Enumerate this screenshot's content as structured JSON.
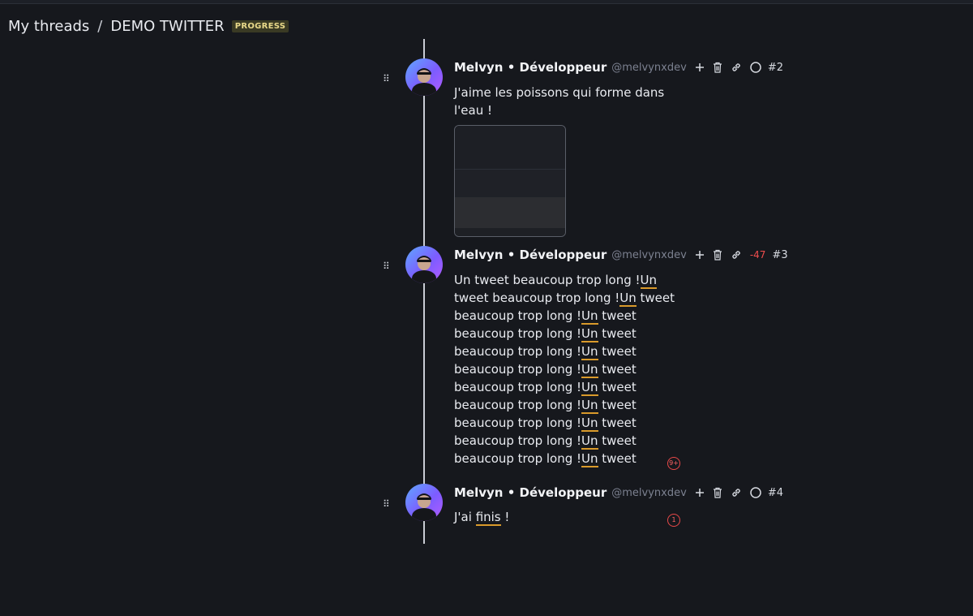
{
  "breadcrumb": {
    "root": "My threads",
    "separator": "/",
    "current": "DEMO TWITTER",
    "badge": "PROGRESS"
  },
  "tweets": [
    {
      "author": "Melvyn • Développeur",
      "handle": "@melvynxdev",
      "index": "#2",
      "lines": [
        "J'aime les poissons qui forme dans",
        "l'eau !"
      ],
      "has_media": true
    },
    {
      "author": "Melvyn • Développeur",
      "handle": "@melvynxdev",
      "index": "#3",
      "char_count": "-47",
      "lines_first": [
        "Un tweet beaucoup trop long !",
        "Un"
      ],
      "line2": [
        "tweet beaucoup trop long !",
        "Un",
        " tweet"
      ],
      "repeat_pre": "beaucoup trop long !",
      "repeat_u": "Un",
      "repeat_post": " tweet",
      "issues_badge": "9+"
    },
    {
      "author": "Melvyn • Développeur",
      "handle": "@melvynxdev",
      "index": "#4",
      "text_pre": "J'ai ",
      "text_u": "finis",
      "text_post": " !",
      "issues_badge": "1"
    }
  ],
  "icons": {
    "add": "plus-icon",
    "delete": "trash-icon",
    "link": "link-icon",
    "status": "circle-icon"
  },
  "colors": {
    "accent_underline": "#d99a2b",
    "error": "#e84848",
    "background": "#16181d"
  }
}
